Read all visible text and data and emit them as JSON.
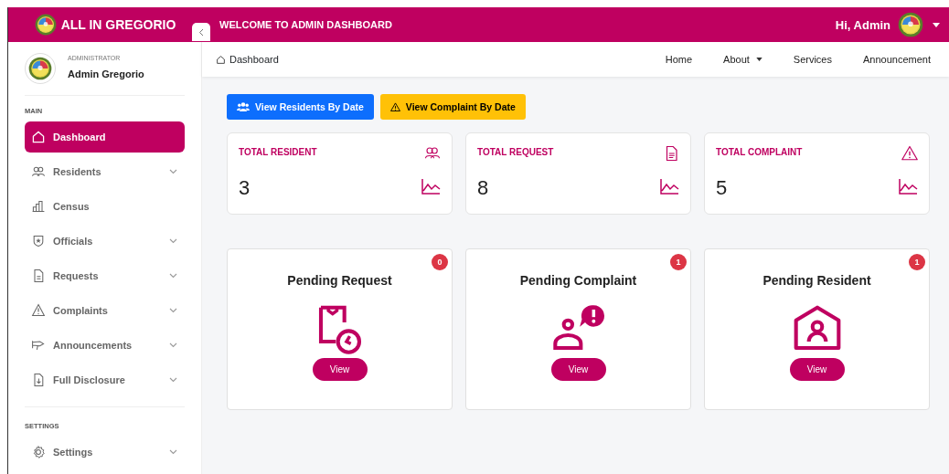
{
  "header": {
    "brand": "ALL IN GREGORIO",
    "title": "WELCOME TO ADMIN DASHBOARD",
    "greeting": "Hi, Admin"
  },
  "profile": {
    "role": "ADMINISTRATOR",
    "name": "Admin Gregorio"
  },
  "sidebar": {
    "sections": [
      {
        "label": "MAIN",
        "items": [
          {
            "label": "Dashboard",
            "selected": true,
            "expandable": false
          },
          {
            "label": "Residents",
            "selected": false,
            "expandable": true
          },
          {
            "label": "Census",
            "selected": false,
            "expandable": false
          },
          {
            "label": "Officials",
            "selected": false,
            "expandable": true
          },
          {
            "label": "Requests",
            "selected": false,
            "expandable": true
          },
          {
            "label": "Complaints",
            "selected": false,
            "expandable": true
          },
          {
            "label": "Announcements",
            "selected": false,
            "expandable": true
          },
          {
            "label": "Full Disclosure",
            "selected": false,
            "expandable": true
          }
        ]
      },
      {
        "label": "SETTINGS",
        "items": [
          {
            "label": "Settings",
            "selected": false,
            "expandable": true
          }
        ]
      }
    ]
  },
  "breadcrumb": "Dashboard",
  "nav": [
    {
      "label": "Home",
      "dropdown": false
    },
    {
      "label": "About",
      "dropdown": true
    },
    {
      "label": "Services",
      "dropdown": false
    },
    {
      "label": "Announcement",
      "dropdown": false
    }
  ],
  "actions": [
    {
      "label": "View Residents By Date",
      "kind": "primary"
    },
    {
      "label": "View Complaint By Date",
      "kind": "warning"
    }
  ],
  "stats": [
    {
      "label": "TOTAL RESIDENT",
      "value": "3"
    },
    {
      "label": "TOTAL REQUEST",
      "value": "8"
    },
    {
      "label": "TOTAL COMPLAINT",
      "value": "5"
    }
  ],
  "pending": [
    {
      "title": "Pending Request",
      "count": "0",
      "button": "View"
    },
    {
      "title": "Pending Complaint",
      "count": "1",
      "button": "View"
    },
    {
      "title": "Pending Resident",
      "count": "1",
      "button": "View"
    }
  ]
}
